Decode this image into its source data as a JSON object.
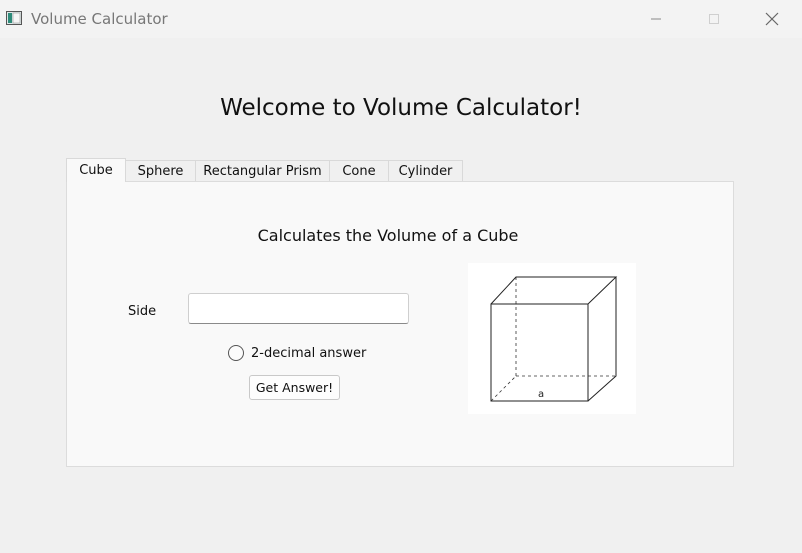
{
  "window": {
    "title": "Volume Calculator"
  },
  "header": {
    "title": "Welcome to Volume Calculator!"
  },
  "tabs": [
    {
      "label": "Cube",
      "active": true
    },
    {
      "label": "Sphere"
    },
    {
      "label": "Rectangular Prism"
    },
    {
      "label": "Cone"
    },
    {
      "label": "Cylinder"
    }
  ],
  "cube": {
    "heading": "Calculates the Volume of a Cube",
    "side_label": "Side",
    "side_value": "",
    "radio_label": "2-decimal answer",
    "radio_checked": false,
    "button_label": "Get Answer!",
    "diagram_label": "a"
  },
  "icons": {
    "app": "app-window-icon",
    "minimize": "minimize-icon",
    "maximize": "maximize-icon",
    "close": "close-icon"
  }
}
